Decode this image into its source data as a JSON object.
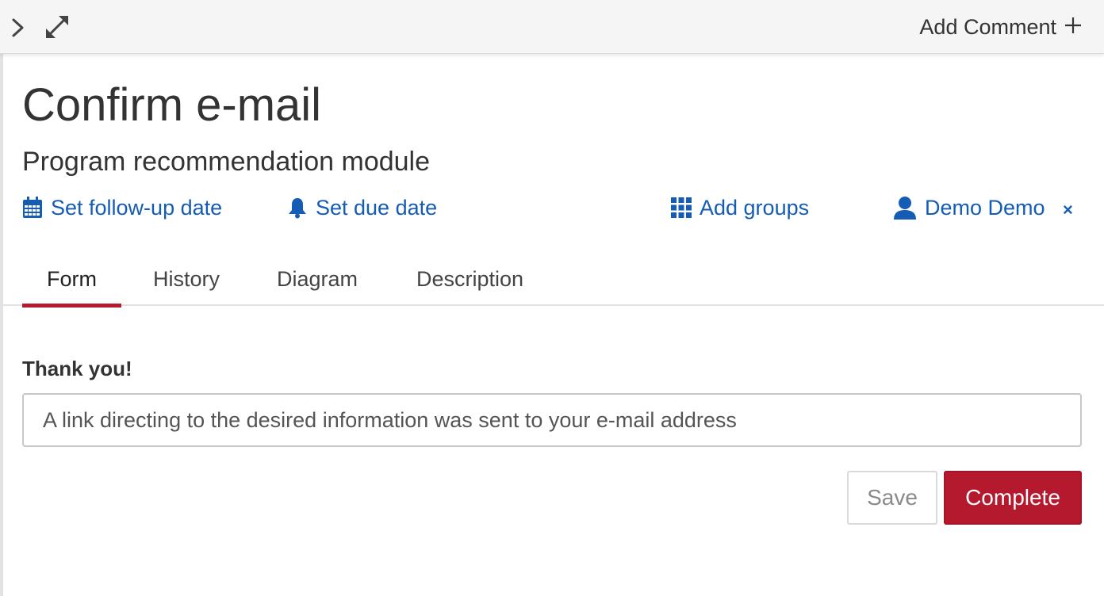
{
  "toolbar": {
    "add_comment_label": "Add Comment",
    "add_comment_icon": "plus-icon",
    "collapse_icon": "chevron-right-icon",
    "expand_icon": "expand-arrows-icon"
  },
  "task": {
    "title": "Confirm e-mail",
    "subtitle": "Program recommendation module"
  },
  "actions": {
    "follow_up": {
      "label": "Set follow-up date",
      "icon": "calendar-icon"
    },
    "due_date": {
      "label": "Set due date",
      "icon": "bell-icon"
    },
    "groups": {
      "label": "Add groups",
      "icon": "grid-icon"
    },
    "assignee": {
      "label": "Demo Demo",
      "icon": "user-icon",
      "remove_symbol": "×"
    }
  },
  "tabs": [
    {
      "label": "Form",
      "active": true
    },
    {
      "label": "History",
      "active": false
    },
    {
      "label": "Diagram",
      "active": false
    },
    {
      "label": "Description",
      "active": false
    }
  ],
  "form": {
    "label": "Thank you!",
    "value": "A link directing to the desired information was sent to your e-mail address"
  },
  "buttons": {
    "save": "Save",
    "complete": "Complete"
  },
  "colors": {
    "accent": "#b5192e",
    "link": "#155cb5"
  }
}
